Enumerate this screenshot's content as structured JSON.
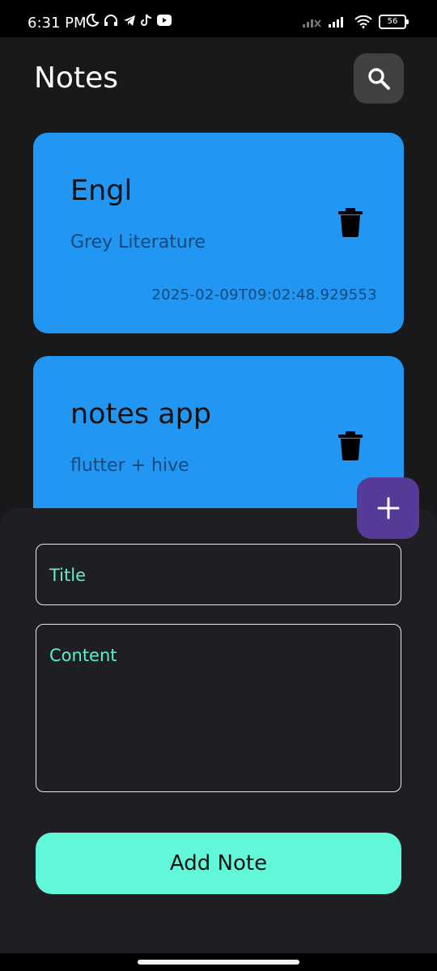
{
  "status_bar": {
    "time": "6:31 PM",
    "battery": "56"
  },
  "app_bar": {
    "title": "Notes"
  },
  "notes": [
    {
      "title": "Engl",
      "content": "Grey Literature",
      "date": "2025-02-09T09:02:48.929553"
    },
    {
      "title": "notes app",
      "content": "flutter + hive"
    }
  ],
  "form": {
    "title_label": "Title",
    "content_label": "Content",
    "submit_label": "Add Note"
  },
  "colors": {
    "card": "#2196f3",
    "accent": "#60f8d8",
    "fab": "#553b97",
    "background": "#19181b"
  }
}
